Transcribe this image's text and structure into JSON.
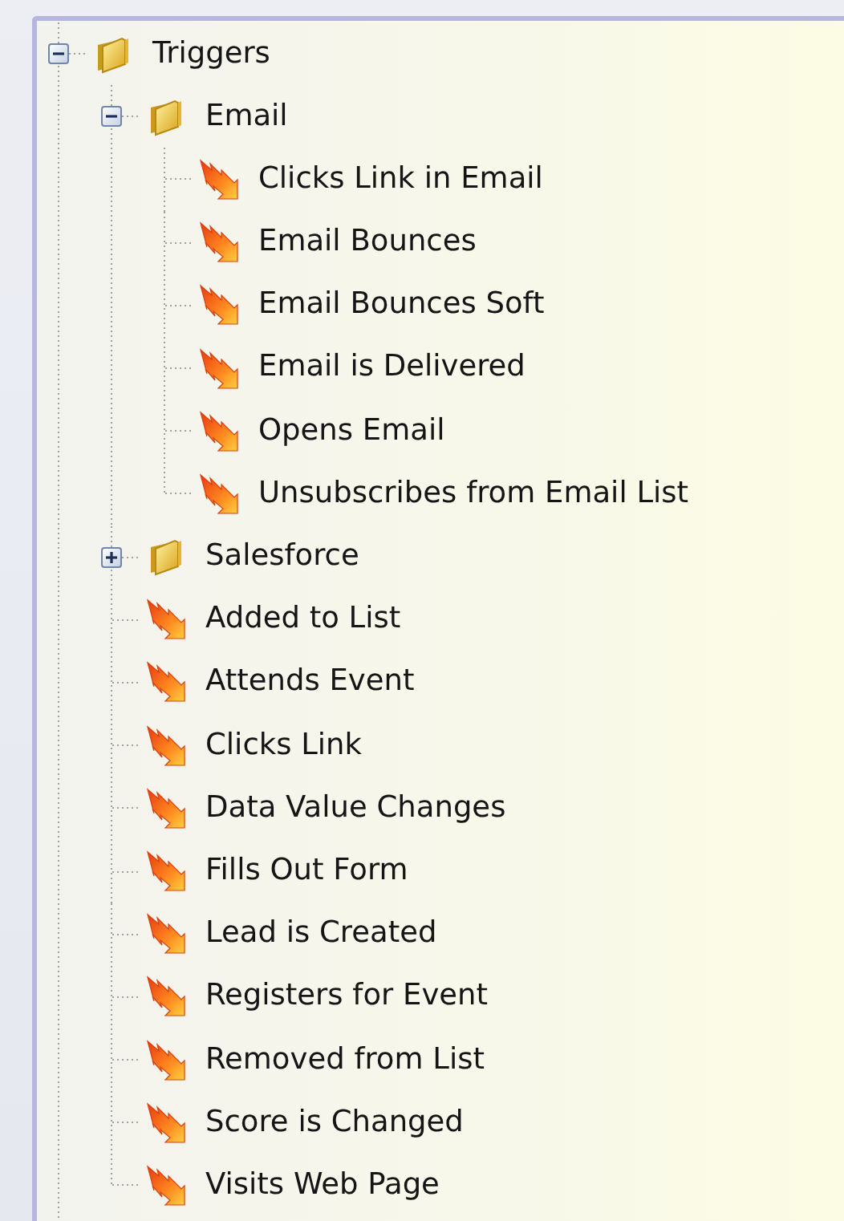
{
  "tree": [
    {
      "label": "Triggers",
      "kind": "folder",
      "expanded": true,
      "children": [
        {
          "label": "Email",
          "kind": "folder",
          "expanded": true,
          "children": [
            {
              "label": "Clicks Link in Email",
              "kind": "trigger"
            },
            {
              "label": "Email Bounces",
              "kind": "trigger"
            },
            {
              "label": "Email Bounces Soft",
              "kind": "trigger"
            },
            {
              "label": "Email is Delivered",
              "kind": "trigger"
            },
            {
              "label": "Opens Email",
              "kind": "trigger"
            },
            {
              "label": "Unsubscribes from Email List",
              "kind": "trigger"
            }
          ]
        },
        {
          "label": "Salesforce",
          "kind": "folder",
          "expanded": false
        },
        {
          "label": "Added to List",
          "kind": "trigger"
        },
        {
          "label": "Attends Event",
          "kind": "trigger"
        },
        {
          "label": "Clicks Link",
          "kind": "trigger"
        },
        {
          "label": "Data Value Changes",
          "kind": "trigger"
        },
        {
          "label": "Fills Out Form",
          "kind": "trigger"
        },
        {
          "label": "Lead is Created",
          "kind": "trigger"
        },
        {
          "label": "Registers for Event",
          "kind": "trigger"
        },
        {
          "label": "Removed from List",
          "kind": "trigger"
        },
        {
          "label": "Score is Changed",
          "kind": "trigger"
        },
        {
          "label": "Visits Web Page",
          "kind": "trigger"
        }
      ]
    }
  ]
}
